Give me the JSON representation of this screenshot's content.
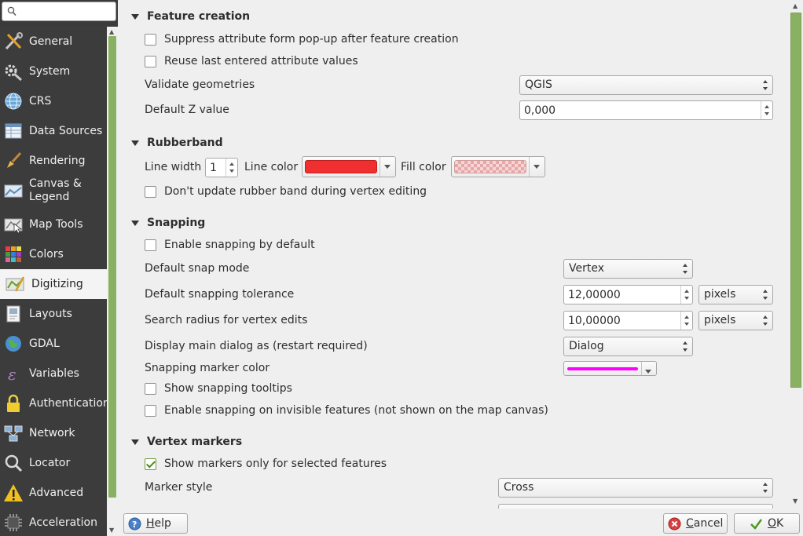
{
  "search": {
    "value": "",
    "placeholder": ""
  },
  "sidebar": {
    "items": [
      {
        "label": "General",
        "icon": "tools-icon"
      },
      {
        "label": "System",
        "icon": "gear-icon"
      },
      {
        "label": "CRS",
        "icon": "globe-grid-icon"
      },
      {
        "label": "Data Sources",
        "icon": "table-icon"
      },
      {
        "label": "Rendering",
        "icon": "paintbrush-icon"
      },
      {
        "label": "Canvas & Legend",
        "icon": "map-canvas-icon"
      },
      {
        "label": "Map Tools",
        "icon": "map-pointer-icon"
      },
      {
        "label": "Colors",
        "icon": "color-palette-icon"
      },
      {
        "label": "Digitizing",
        "icon": "digitizing-icon",
        "active": true
      },
      {
        "label": "Layouts",
        "icon": "layouts-icon"
      },
      {
        "label": "GDAL",
        "icon": "gdal-globe-icon"
      },
      {
        "label": "Variables",
        "icon": "epsilon-icon"
      },
      {
        "label": "Authentication",
        "icon": "lock-icon"
      },
      {
        "label": "Network",
        "icon": "network-icon"
      },
      {
        "label": "Locator",
        "icon": "magnifier-icon"
      },
      {
        "label": "Advanced",
        "icon": "warning-icon"
      },
      {
        "label": "Acceleration",
        "icon": "chip-icon"
      }
    ]
  },
  "feature_creation": {
    "title": "Feature creation",
    "suppress_label": "Suppress attribute form pop-up after feature creation",
    "suppress_checked": false,
    "reuse_label": "Reuse last entered attribute values",
    "reuse_checked": false,
    "validate_label": "Validate geometries",
    "validate_value": "QGIS",
    "default_z_label": "Default Z value",
    "default_z_value": "0,000"
  },
  "rubberband": {
    "title": "Rubberband",
    "line_width_label": "Line width",
    "line_width_value": "1",
    "line_color_label": "Line color",
    "line_color": "#f03030",
    "fill_color_label": "Fill color",
    "fill_color": "#f5c8c8",
    "dont_update_label": "Don't update rubber band during vertex editing",
    "dont_update_checked": false
  },
  "snapping": {
    "title": "Snapping",
    "enable_label": "Enable snapping by default",
    "enable_checked": false,
    "mode_label": "Default snap mode",
    "mode_value": "Vertex",
    "tolerance_label": "Default snapping tolerance",
    "tolerance_value": "12,00000",
    "tolerance_unit": "pixels",
    "radius_label": "Search radius for vertex edits",
    "radius_value": "10,00000",
    "radius_unit": "pixels",
    "dialog_label": "Display main dialog as (restart required)",
    "dialog_value": "Dialog",
    "marker_color_label": "Snapping marker color",
    "marker_color": "#ff00ff",
    "tooltips_label": "Show snapping tooltips",
    "tooltips_checked": false,
    "invisible_label": "Enable snapping on invisible features (not shown on the map canvas)",
    "invisible_checked": false
  },
  "vertex_markers": {
    "title": "Vertex markers",
    "selected_only_label": "Show markers only for selected features",
    "selected_only_checked": true,
    "style_label": "Marker style",
    "style_value": "Cross"
  },
  "buttons": {
    "help": "Help",
    "cancel": "Cancel",
    "ok": "OK"
  },
  "colors": {
    "accent_green": "#8ab061",
    "sidebar_bg": "#3c3c3c"
  }
}
